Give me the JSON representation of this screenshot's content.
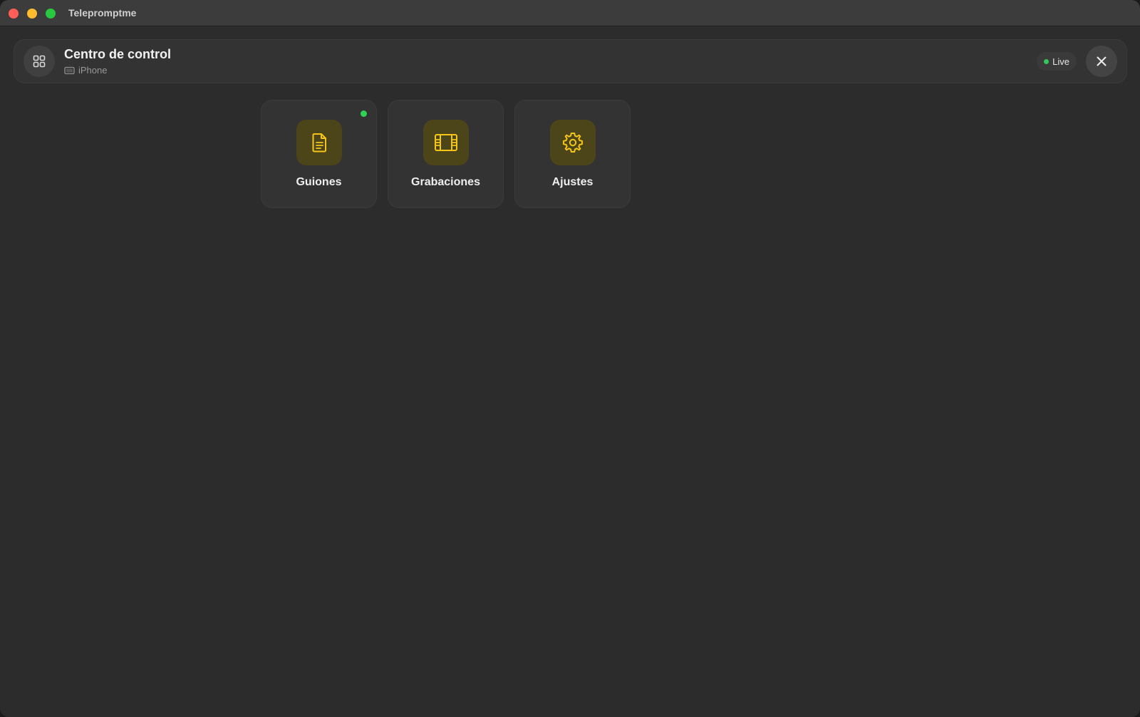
{
  "window": {
    "app_title": "Telepromptme"
  },
  "control_bar": {
    "title": "Centro de control",
    "device_icon": "device-icon",
    "device_name": "iPhone",
    "live_label": "Live",
    "menu_icon": "grid-icon",
    "close_icon": "close-icon"
  },
  "tiles": [
    {
      "label": "Guiones",
      "icon": "document-icon",
      "has_indicator": true
    },
    {
      "label": "Grabaciones",
      "icon": "film-icon",
      "has_indicator": false
    },
    {
      "label": "Ajustes",
      "icon": "gear-icon",
      "has_indicator": false
    }
  ],
  "colors": {
    "traffic_close": "#ff5f57",
    "traffic_min": "#febc2e",
    "traffic_max": "#28c840",
    "accent_yellow": "#f5c518",
    "live_green": "#34c759",
    "indicator_green": "#30d158"
  }
}
